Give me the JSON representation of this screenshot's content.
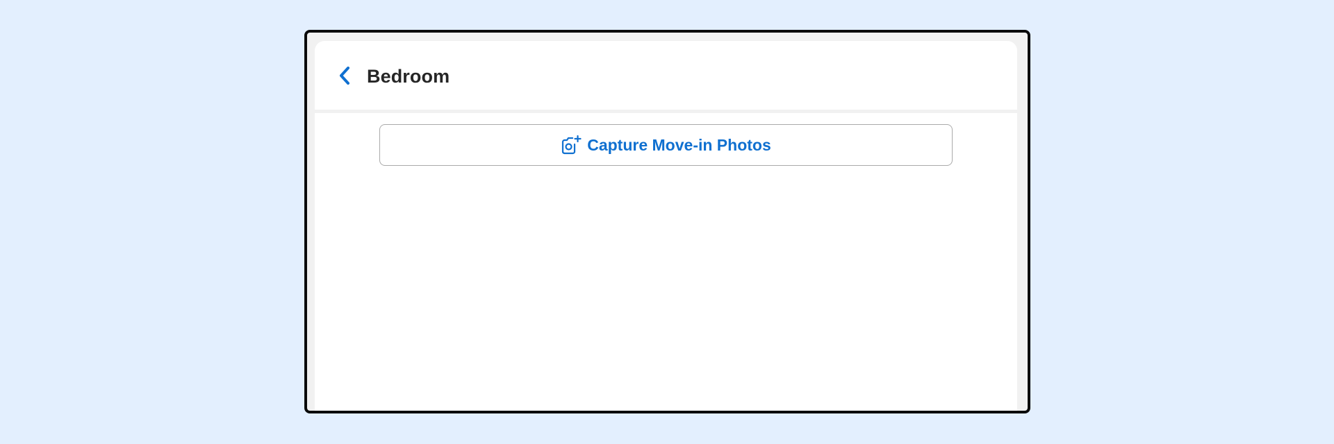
{
  "header": {
    "title": "Bedroom",
    "back_icon": "chevron-left-icon"
  },
  "actions": {
    "capture_label": "Capture Move-in Photos",
    "capture_icon": "camera-add-icon"
  },
  "colors": {
    "page_background": "#e3effe",
    "accent": "#1070d0",
    "title_text": "#262626",
    "frame": "#0a0a0a"
  }
}
